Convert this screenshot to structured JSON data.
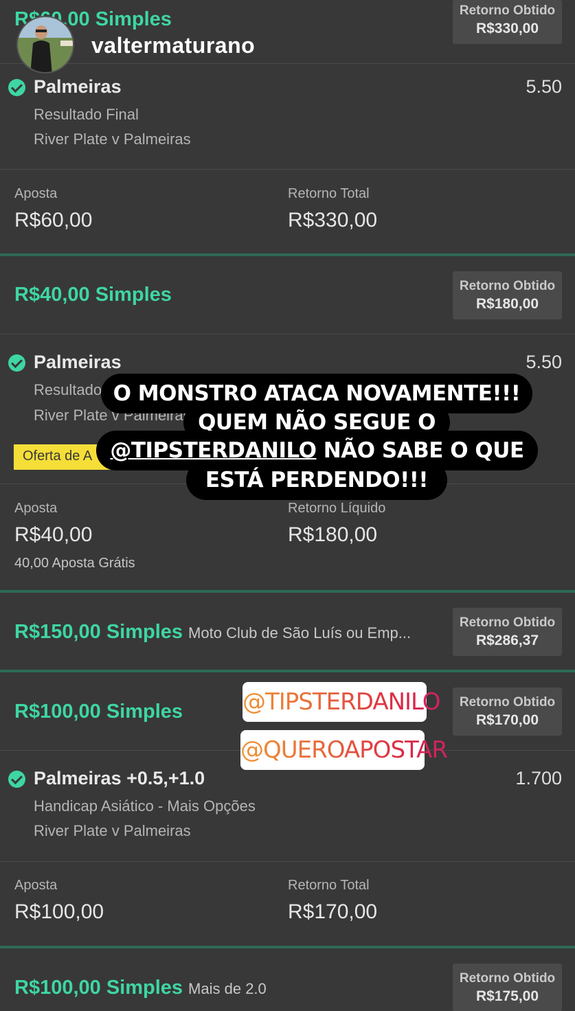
{
  "story": {
    "username": "valtermaturano",
    "caption_lines": [
      "O MONSTRO ATACA NOVAMENTE!!!",
      "QUEM NÃO SEGUE O",
      "NÃO SABE O QUE",
      "ESTÁ PERDENDO!!!"
    ],
    "caption_mention": "@TIPSTERDANILO",
    "stickers": [
      "@TIPSTERDANILO",
      "@QUEROAPOSTAR"
    ]
  },
  "bets": [
    {
      "header": "R$60,00 Simples",
      "returned_label": "Retorno Obtido",
      "returned_value": "R$330,00",
      "selection": "Palmeiras",
      "odds": "5.50",
      "market": "Resultado Final",
      "event": "River Plate v Palmeiras",
      "stake_label": "Aposta",
      "stake_value": "R$60,00",
      "return_label": "Retorno Total",
      "return_value": "R$330,00"
    },
    {
      "header": "R$40,00 Simples",
      "returned_label": "Retorno Obtido",
      "returned_value": "R$180,00",
      "selection": "Palmeiras",
      "odds": "5.50",
      "market": "Resultado",
      "event": "River Plate v Palmeiras",
      "offer": "Oferta de A",
      "stake_label": "Aposta",
      "stake_value": "R$40,00",
      "free_bet": "40,00 Aposta Grátis",
      "return_label": "Retorno Líquido",
      "return_value": "R$180,00"
    },
    {
      "header": "R$150,00 Simples",
      "header_extra": "Moto Club de São Luís ou Emp...",
      "returned_label": "Retorno Obtido",
      "returned_value": "R$286,37"
    },
    {
      "header": "R$100,00 Simples",
      "returned_label": "Retorno Obtido",
      "returned_value": "R$170,00",
      "selection": "Palmeiras +0.5,+1.0",
      "odds": "1.700",
      "market": "Handicap Asiático - Mais Opções",
      "event": "River Plate v Palmeiras",
      "stake_label": "Aposta",
      "stake_value": "R$100,00",
      "return_label": "Retorno Total",
      "return_value": "R$170,00"
    },
    {
      "header": "R$100,00 Simples",
      "header_extra": "Mais de 2.0",
      "returned_label": "Retorno Obtido",
      "returned_value": "R$175,00"
    }
  ],
  "colors": {
    "background": "#383838",
    "accent_green": "#3ed6a2",
    "offer_yellow": "#f5de38"
  }
}
